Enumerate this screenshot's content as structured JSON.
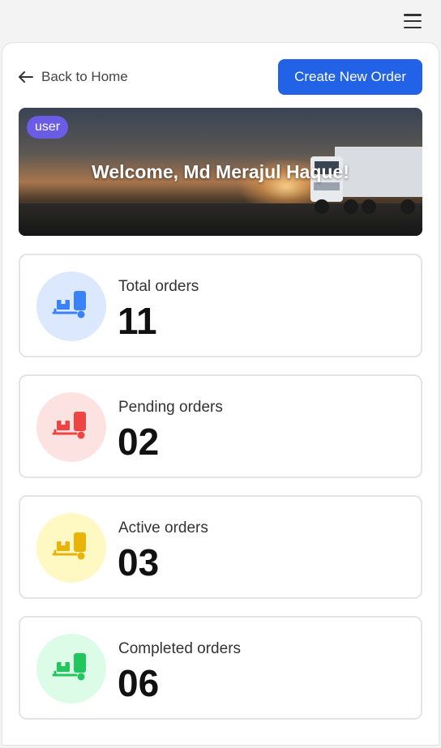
{
  "nav": {
    "menu_icon": "hamburger-icon"
  },
  "header": {
    "back_label": "Back to Home",
    "back_icon": "arrow-left-icon",
    "create_label": "Create New Order",
    "accent": "#2162e6"
  },
  "hero": {
    "badge": "user",
    "badge_color": "#6a5ce6",
    "welcome": "Welcome, Md Merajul Haque!"
  },
  "stats": [
    {
      "label": "Total orders",
      "value": "11",
      "icon": "truck-box-icon",
      "icon_color": "#3b82f6",
      "bg": "#dbe8fe"
    },
    {
      "label": "Pending orders",
      "value": "02",
      "icon": "truck-box-icon",
      "icon_color": "#ef4444",
      "bg": "#fde2e2"
    },
    {
      "label": "Active orders",
      "value": "03",
      "icon": "truck-box-icon",
      "icon_color": "#eab308",
      "bg": "#fef8c3"
    },
    {
      "label": "Completed orders",
      "value": "06",
      "icon": "truck-box-icon",
      "icon_color": "#22c55e",
      "bg": "#dcfce7"
    }
  ]
}
